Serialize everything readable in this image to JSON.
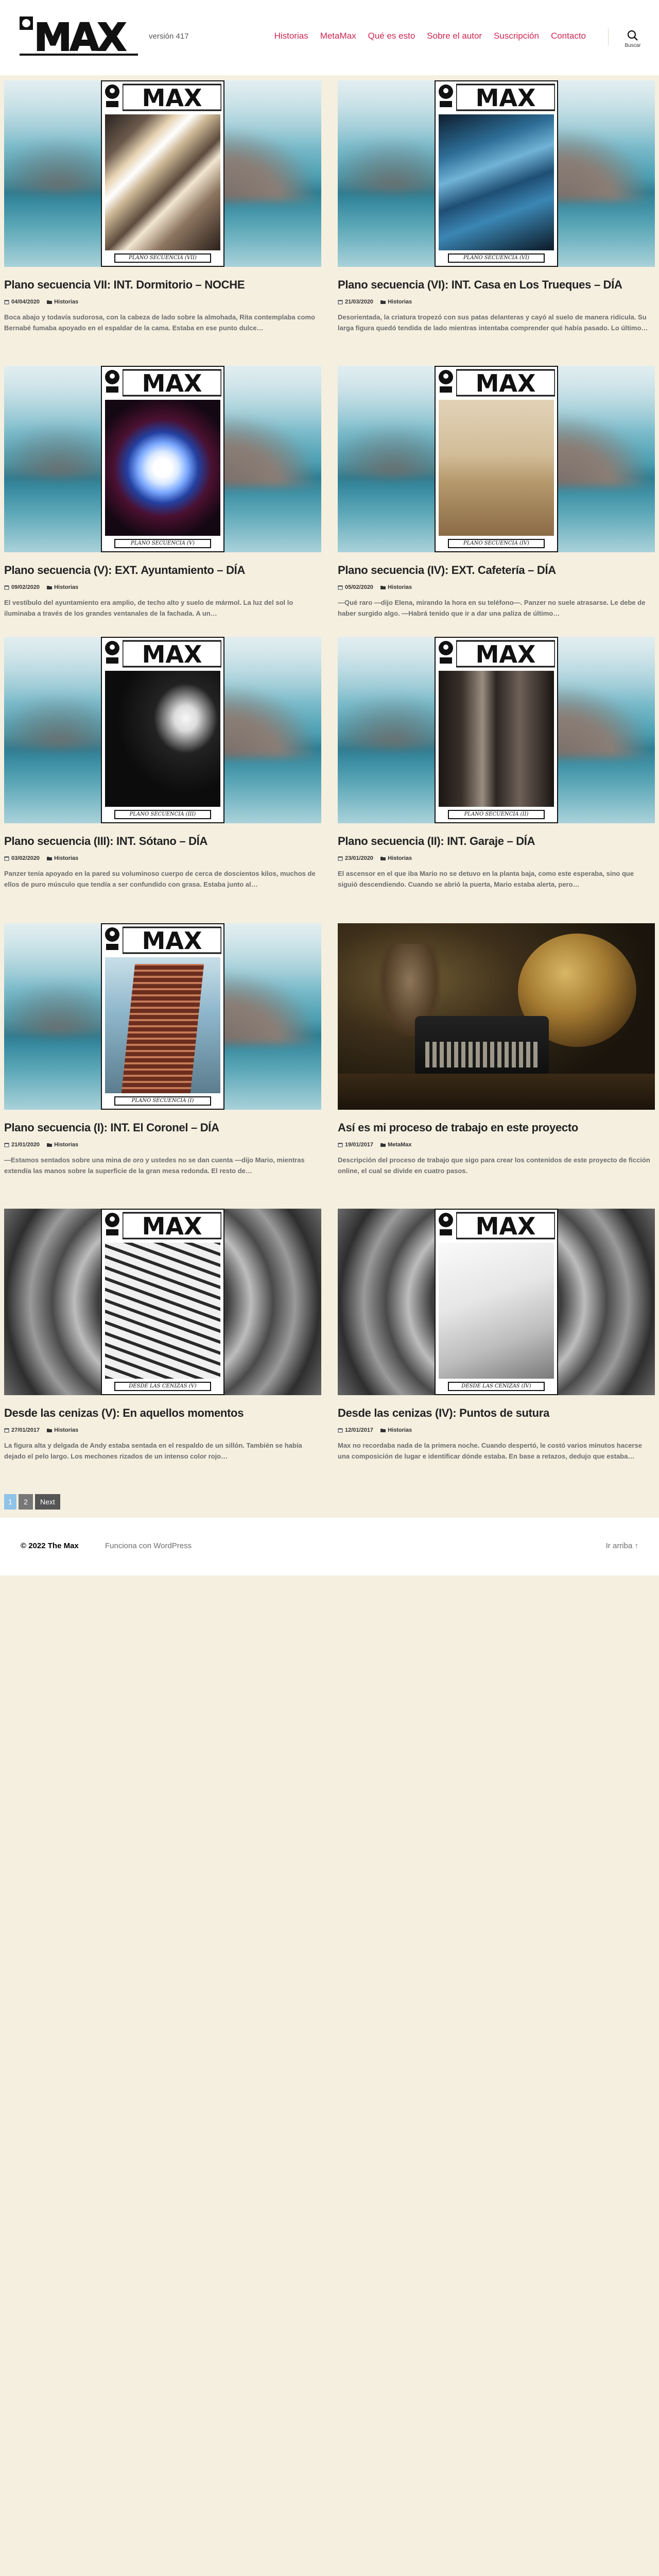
{
  "header": {
    "logo_text": "MAX",
    "version": "versión 417",
    "nav": [
      "Historias",
      "MetaMax",
      "Qué es esto",
      "Sobre el autor",
      "Suscripción",
      "Contacto"
    ],
    "search_label": "Buscar",
    "accent": "#cd2653"
  },
  "posts": [
    {
      "title": "Plano secuencia VII: INT. Dormitorio – NOCHE",
      "date": "04/04/2020",
      "category": "Historias",
      "caption": "PLANO SECUENCIA (VII)",
      "excerpt": "Boca abajo y todavía sudorosa, con la cabeza de lado sobre la almohada, Rita contemplaba como Bernabé fumaba apoyado en el espaldar de la cama. Estaba en ese punto dulce…"
    },
    {
      "title": "Plano secuencia (VI): INT. Casa en Los Trueques – DÍA",
      "date": "21/03/2020",
      "category": "Historias",
      "caption": "PLANO SECUENCIA (VI)",
      "excerpt": "Desorientada, la criatura tropezó con sus patas delanteras y cayó al suelo de manera ridícula. Su larga figura quedó tendida de lado mientras intentaba comprender qué había pasado. Lo último…"
    },
    {
      "title": "Plano secuencia (V): EXT. Ayuntamiento – DÍA",
      "date": "09/02/2020",
      "category": "Historias",
      "caption": "PLANO SECUENCIA (V)",
      "excerpt": "El vestíbulo del ayuntamiento era amplio, de techo alto y suelo de mármol. La luz del sol lo iluminaba a través de los grandes ventanales de la fachada. A un…"
    },
    {
      "title": "Plano secuencia (IV): EXT. Cafetería – DÍA",
      "date": "05/02/2020",
      "category": "Historias",
      "caption": "PLANO SECUENCIA (IV)",
      "excerpt": "—Qué raro —dijo Elena, mirando la hora en su teléfono—. Panzer no suele atrasarse. Le debe de haber surgido algo. —Habrá tenido que ir a dar una paliza de último…"
    },
    {
      "title": "Plano secuencia (III): INT. Sótano – DÍA",
      "date": "03/02/2020",
      "category": "Historias",
      "caption": "PLANO SECUENCIA (III)",
      "excerpt": "Panzer tenía apoyado en la pared su voluminoso cuerpo de cerca de doscientos kilos, muchos de ellos de puro músculo que tendía a ser confundido con grasa. Estaba junto al…"
    },
    {
      "title": "Plano secuencia (II): INT. Garaje – DÍA",
      "date": "23/01/2020",
      "category": "Historias",
      "caption": "PLANO SECUENCIA (II)",
      "excerpt": "El ascensor en el que iba Mario no se detuvo en la planta baja, como este esperaba, sino que siguió descendiendo. Cuando se abrió la puerta, Mario estaba alerta, pero…"
    },
    {
      "title": "Plano secuencia (I): INT. El Coronel – DÍA",
      "date": "21/01/2020",
      "category": "Historias",
      "caption": "PLANO SECUENCIA (I)",
      "excerpt": "—Estamos sentados sobre una mina de oro y ustedes no se dan cuenta —dijo Mario, mientras extendía las manos sobre la superficie de la gran mesa redonda. El resto de…"
    },
    {
      "title": "Así es mi proceso de trabajo en este proyecto",
      "date": "19/01/2017",
      "category": "MetaMax",
      "caption": "",
      "excerpt": "Descripción del proceso de trabajo que sigo para crear los contenidos de este proyecto de ficción online, el cual se divide en cuatro pasos."
    },
    {
      "title": "Desde las cenizas (V): En aquellos momentos",
      "date": "27/01/2017",
      "category": "Historias",
      "caption": "DESDE LAS CENIZAS (V)",
      "excerpt": "La figura alta y delgada de Andy estaba sentada en el respaldo de un sillón. También se había dejado el pelo largo. Los mechones rizados de un intenso color rojo…"
    },
    {
      "title": "Desde las cenizas (IV): Puntos de sutura",
      "date": "12/01/2017",
      "category": "Historias",
      "caption": "DESDE LAS CENIZAS (IV)",
      "excerpt": "Max no recordaba nada de la primera noche. Cuando despertó, le costó varios minutos hacerse una composición de lugar e identificar dónde estaba. En base a retazos, dedujo que estaba…"
    }
  ],
  "pagination": {
    "current": "1",
    "page2": "2",
    "next": "Next"
  },
  "footer": {
    "copyright": "© 2022 The Max",
    "powered": "Funciona con WordPress",
    "to_top": "Ir arriba ↑"
  }
}
